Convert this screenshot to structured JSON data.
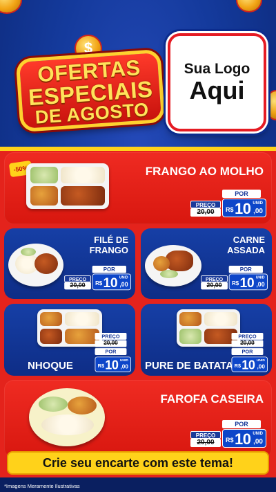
{
  "header": {
    "promo_title": [
      "OFERTAS",
      "ESPECIAIS",
      "DE AGOSTO"
    ],
    "dollar_symbol": "$",
    "logo_line1": "Sua Logo",
    "logo_line2": "Aqui"
  },
  "colors": {
    "brand_red": "#e4231c",
    "brand_blue": "#0e2d86",
    "accent_yellow": "#ffd21a"
  },
  "labels": {
    "por": "POR",
    "preco": "PREÇO",
    "currency": "R$",
    "unid": "UNID"
  },
  "products": [
    {
      "name_lines": [
        "FRANGO AO MOLHO"
      ],
      "old_price": "20,00",
      "price": "10",
      "cents": ",00",
      "discount": "-50%"
    },
    {
      "name_lines": [
        "FILÉ DE",
        "FRANGO"
      ],
      "old_price": "20,00",
      "price": "10",
      "cents": ",00"
    },
    {
      "name_lines": [
        "CARNE",
        "ASSADA"
      ],
      "old_price": "20,00",
      "price": "10",
      "cents": ",00"
    },
    {
      "name_lines": [
        "NHOQUE"
      ],
      "old_price": "20,00",
      "price": "10",
      "cents": ",00"
    },
    {
      "name_lines": [
        "PURE DE BATATA"
      ],
      "old_price": "20,00",
      "price": "10",
      "cents": ",00"
    },
    {
      "name_lines": [
        "FAROFA CASEIRA"
      ],
      "old_price": "20,00",
      "price": "10",
      "cents": ",00"
    }
  ],
  "cta": "Crie seu encarte com este tema!",
  "disclaimer": "*Imagens Meramente Ilustrativas"
}
